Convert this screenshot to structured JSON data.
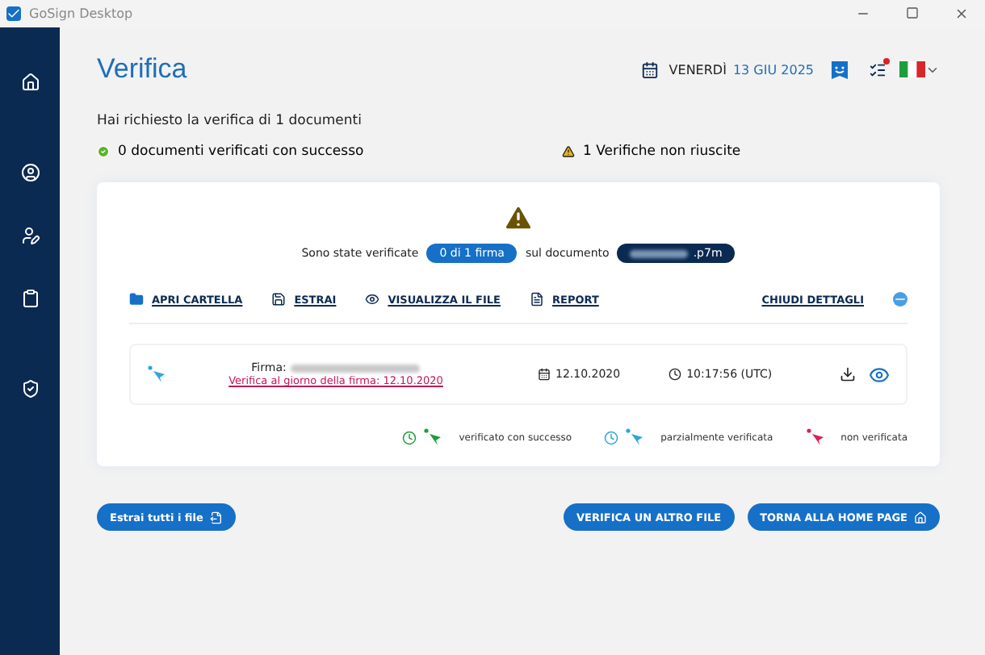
{
  "window": {
    "title": "GoSign Desktop"
  },
  "page": {
    "title": "Verifica",
    "day": "VENERDÌ",
    "date": "13 GIU 2025"
  },
  "summary": {
    "request": "Hai richiesto la verifica di 1 documenti",
    "success": "0 documenti verificati con successo",
    "failed": "1 Verifiche non riuscite"
  },
  "result": {
    "before": "Sono state verificate",
    "count": "0 di 1 firma",
    "middle": "sul documento",
    "document": ".p7m"
  },
  "actions": [
    {
      "label": "APRI CARTELLA",
      "kind": "folder"
    },
    {
      "label": "ESTRAI",
      "kind": "save"
    },
    {
      "label": "VISUALIZZA IL FILE",
      "kind": "eye"
    },
    {
      "label": "REPORT",
      "kind": "file"
    }
  ],
  "details_toggle": "CHIUDI DETTAGLI",
  "signature": {
    "label": "Firma:",
    "check_link": "Verifica al giorno della firma: 12.10.2020",
    "date": "12.10.2020",
    "time": "10:17:56 (UTC)"
  },
  "legend": [
    {
      "label": "verificato con successo",
      "color": "#1e9e3a",
      "clock": true
    },
    {
      "label": "parzialmente verificata",
      "color": "#2aa7dc",
      "clock": true
    },
    {
      "label": "non verificata",
      "color": "#d6245a",
      "clock": false
    }
  ],
  "buttons": {
    "extract_all": "Estrai tutti i file",
    "verify_other": "VERIFICA UN ALTRO FILE",
    "home": "TORNA ALLA HOME PAGE"
  }
}
